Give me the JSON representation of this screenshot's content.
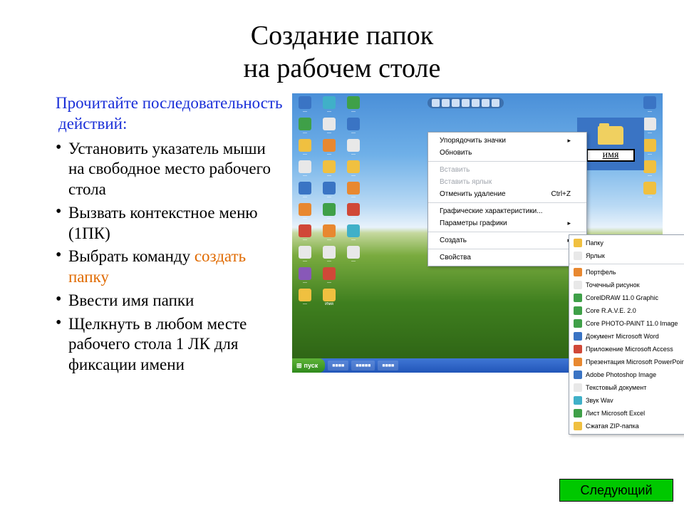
{
  "title_l1": "Создание папок",
  "title_l2": "на рабочем столе",
  "intro": "Прочитайте последовательность действий:",
  "steps": {
    "s1": "Установить указатель мыши на свободное место рабочего стола",
    "s2": "Вызвать контекстное меню (1ПК)",
    "s3a": "Выбрать команду ",
    "s3b": "создать папку",
    "s4": "Ввести имя папки",
    "s5": "Щелкнуть в любом месте рабочего стола 1 ЛК для фиксации имени"
  },
  "newfolder_name": "имя",
  "context_menu": {
    "arrange": "Упорядочить значки",
    "refresh": "Обновить",
    "paste": "Вставить",
    "paste_shortcut": "Вставить ярлык",
    "undo_delete": "Отменить удаление",
    "undo_shortcut": "Ctrl+Z",
    "graphics_props": "Графические характеристики...",
    "graphics_params": "Параметры графики",
    "create": "Создать",
    "properties": "Свойства"
  },
  "submenu": {
    "folder": "Папку",
    "shortcut": "Ярлык",
    "briefcase": "Портфель",
    "bmp": "Точечный рисунок",
    "cdr": "CorelDRAW 11.0 Graphic",
    "rave": "Core R.A.V.E. 2.0",
    "cpt": "Core PHOTO-PAINT 11.0 Image",
    "doc": "Документ Microsoft Word",
    "mdb": "Приложение Microsoft Access",
    "ppt": "Презентация Microsoft PowerPoint",
    "psd": "Adobe Photoshop Image",
    "txt": "Текстовый документ",
    "wav": "Звук Wav",
    "xls": "Лист Microsoft Excel",
    "zip": "Сжатая ZIP-папка"
  },
  "taskbar": {
    "start": "пуск"
  },
  "next": "Следующий"
}
